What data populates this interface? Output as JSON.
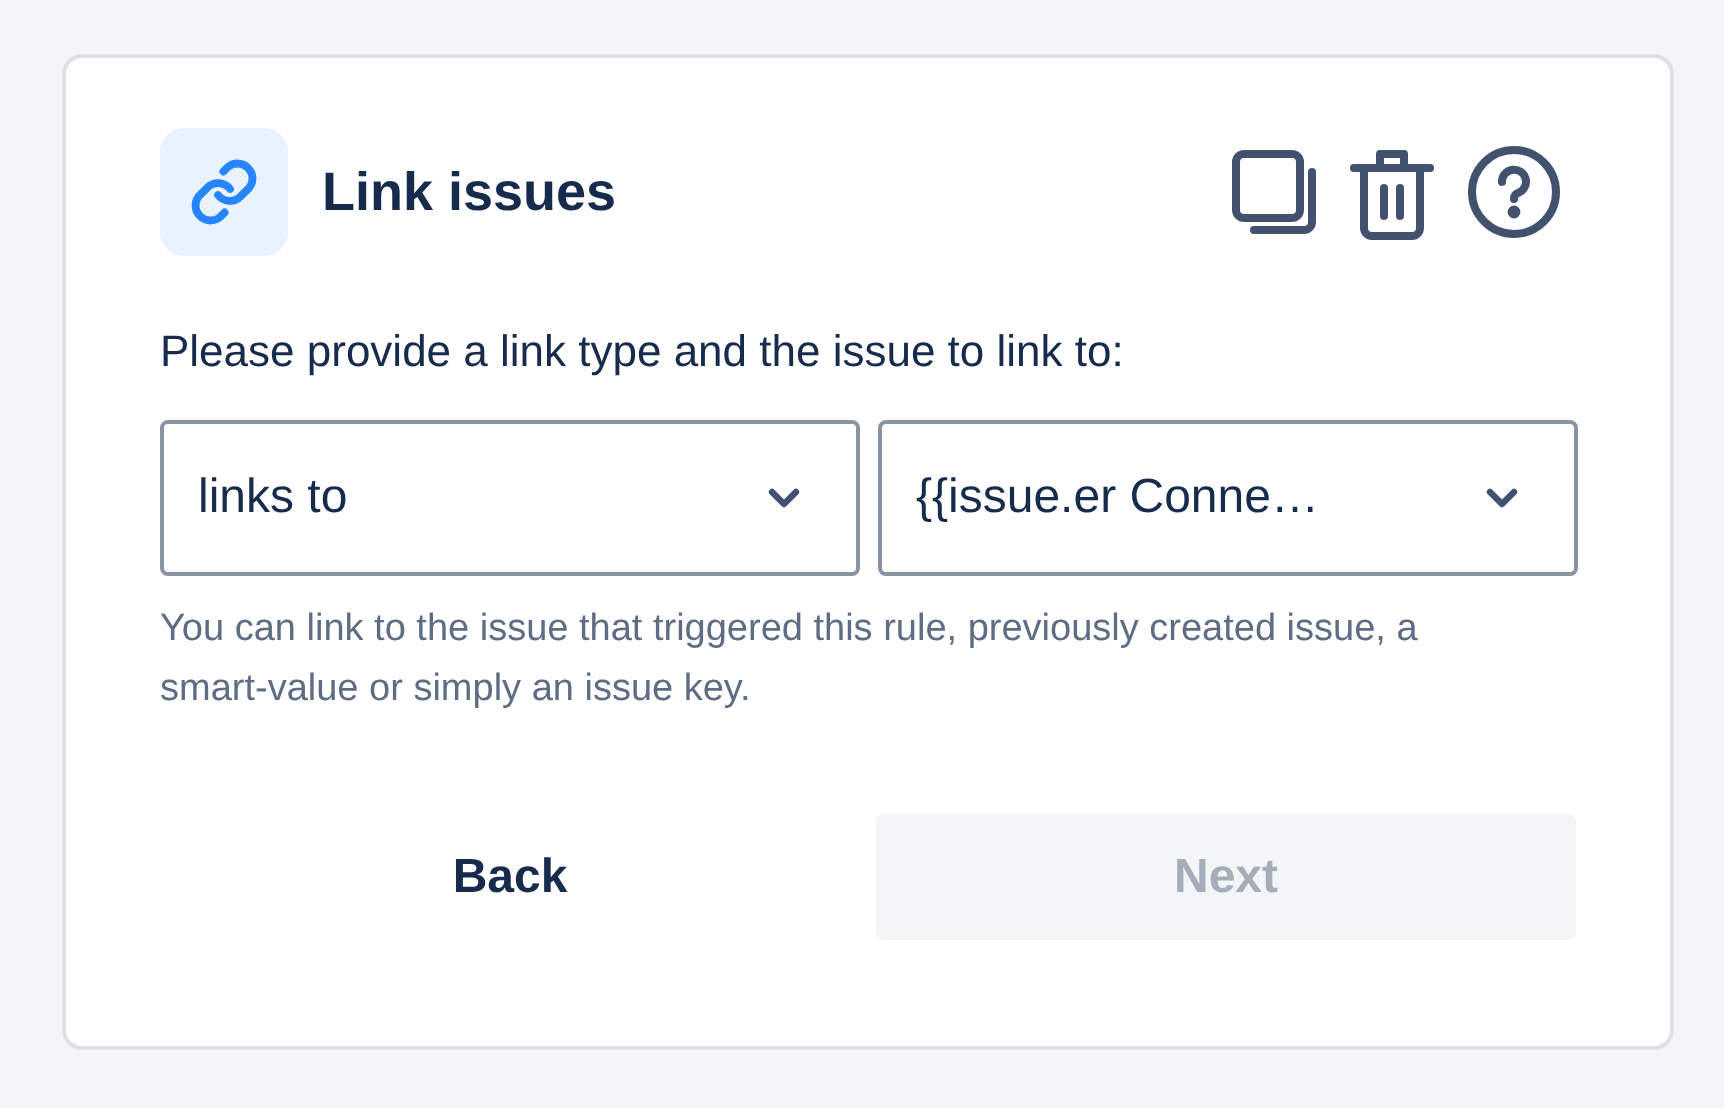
{
  "header": {
    "title": "Link issues"
  },
  "prompt": "Please provide a link type and the issue to link to:",
  "selects": [
    {
      "value": "links to"
    },
    {
      "value": "{{issue.er Conne…"
    }
  ],
  "helper": "You can link to the issue that triggered this rule, previously created issue, a smart-value or simply an issue key.",
  "buttons": [
    {
      "label": "Back",
      "disabled": false
    },
    {
      "label": "Next",
      "disabled": true
    }
  ]
}
